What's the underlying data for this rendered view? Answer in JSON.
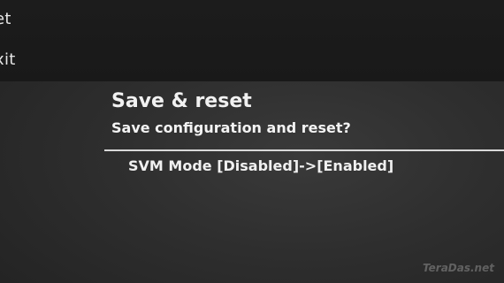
{
  "menu": {
    "items": [
      {
        "label": "et"
      },
      {
        "label": "xit"
      }
    ]
  },
  "dialog": {
    "title": "Save & reset",
    "question": "Save configuration and reset?",
    "changes": [
      {
        "text": "SVM Mode [Disabled]->[Enabled]"
      }
    ]
  },
  "watermark": "TeraDas.net",
  "colors": {
    "background": "#2e2e2e",
    "menu_panel": "#1b1b1b",
    "text": "#f0f0f0",
    "divider": "#d8d8d8"
  }
}
